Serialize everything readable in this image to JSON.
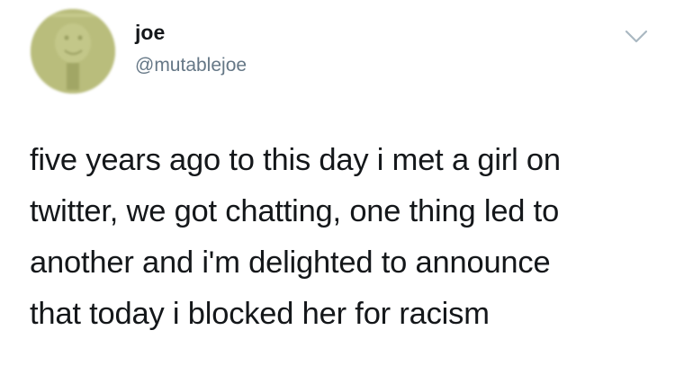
{
  "author": {
    "display_name": "joe",
    "handle": "@mutablejoe",
    "avatar_icon": "profile-avatar"
  },
  "menu": {
    "icon": "chevron-down-icon"
  },
  "tweet": {
    "lines": [
      "five years ago to this day i met a girl on",
      "twitter, we got chatting, one thing led to",
      "another and i'm delighted to announce",
      "that today i blocked her for racism"
    ]
  },
  "colors": {
    "text": "#14171a",
    "secondary": "#657786",
    "chevron": "#aab8c2"
  }
}
